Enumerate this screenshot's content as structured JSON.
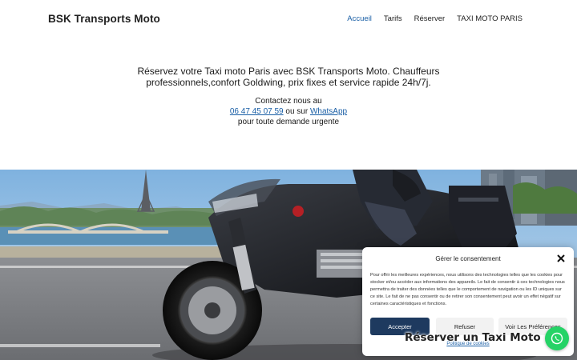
{
  "header": {
    "site_title": "BSK Transports Moto",
    "nav": [
      {
        "label": "Accueil",
        "active": true
      },
      {
        "label": "Tarifs"
      },
      {
        "label": "Réserver"
      },
      {
        "label": "TAXI MOTO PARIS"
      }
    ]
  },
  "intro": {
    "lead": "Réservez votre Taxi moto Paris avec BSK Transports Moto. Chauffeurs professionnels,confort Goldwing, prix fixes et service rapide 24h/7j.",
    "contact_line1": "Contactez nous au",
    "phone": "06 47 45 07 59",
    "or_text": "ou sur",
    "whatsapp_link": "WhatsApp",
    "contact_line3": "pour toute demande urgente"
  },
  "cookie": {
    "title": "Gérer le consentement",
    "text": "Pour offrir les meilleures expériences, nous utilisons des technologies telles que les cookies pour stocker et/ou accéder aux informations des appareils. Le fait de consentir à ces technologies nous permettra de traiter des données telles que le comportement de navigation ou les ID uniques sur ce site. Le fait de ne pas consentir ou de retirer son consentement peut avoir un effet négatif sur certaines caractéristiques et fonctions.",
    "accept": "Accepter",
    "refuse": "Refuser",
    "prefs": "Voir Les Préférences",
    "policy": "Politique de cookies"
  },
  "reserve_banner": "Réserver un Taxi Moto",
  "colors": {
    "accent": "#1a5fa6",
    "accept_button": "#1e3a5f",
    "whatsapp": "#25d366"
  },
  "icons": {
    "close": "close-icon",
    "whatsapp": "whatsapp-icon"
  }
}
